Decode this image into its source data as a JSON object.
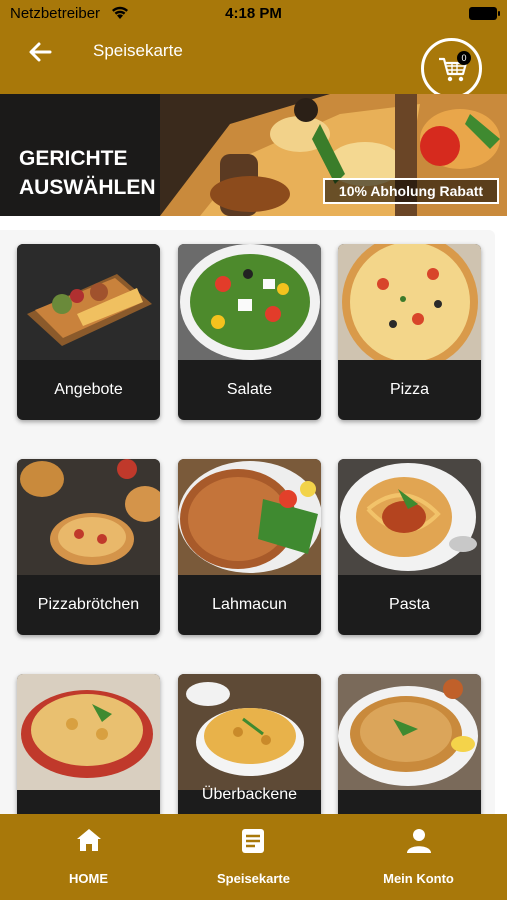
{
  "status_bar": {
    "carrier": "Netzbetreiber",
    "time": "4:18 PM"
  },
  "nav": {
    "title": "Speisekarte",
    "cart_count": "0"
  },
  "banner": {
    "title_line1": "GERICHTE",
    "title_line2": "AUSWÄHLEN",
    "badge": "10% Abholung Rabatt"
  },
  "categories": [
    {
      "label": "Angebote"
    },
    {
      "label": "Salate"
    },
    {
      "label": "Pizza"
    },
    {
      "label": "Pizzabrötchen"
    },
    {
      "label": "Lahmacun"
    },
    {
      "label": "Pasta"
    },
    {
      "label": ""
    },
    {
      "label": "Überbackene"
    },
    {
      "label": ""
    }
  ],
  "tab_bar": {
    "home": "HOME",
    "menu": "Speisekarte",
    "account": "Mein Konto"
  },
  "colors": {
    "brand": "#a8780a",
    "card": "#1c1c1c",
    "text_on_brand": "#ffffff"
  }
}
